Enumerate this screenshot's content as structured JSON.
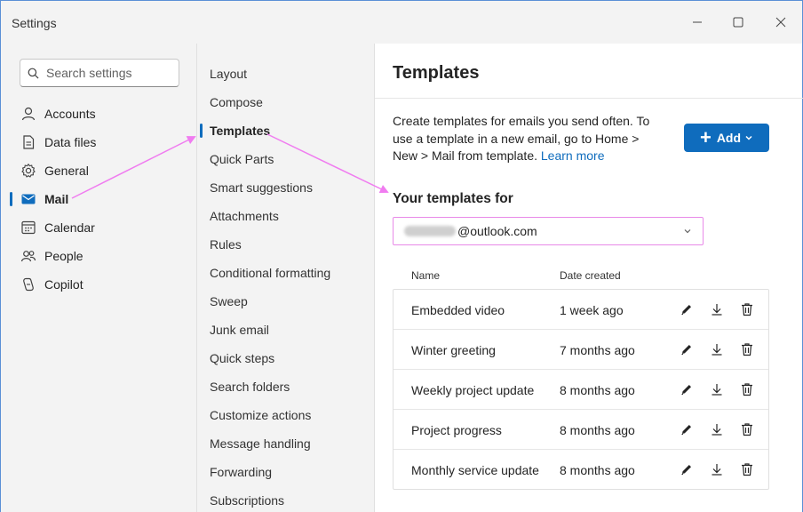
{
  "window": {
    "title": "Settings"
  },
  "search": {
    "placeholder": "Search settings"
  },
  "leftnav": {
    "items": [
      {
        "label": "Accounts",
        "icon": "person-icon"
      },
      {
        "label": "Data files",
        "icon": "document-icon"
      },
      {
        "label": "General",
        "icon": "gear-icon"
      },
      {
        "label": "Mail",
        "icon": "mail-icon",
        "active": true
      },
      {
        "label": "Calendar",
        "icon": "calendar-icon"
      },
      {
        "label": "People",
        "icon": "people-icon"
      },
      {
        "label": "Copilot",
        "icon": "copilot-icon"
      }
    ]
  },
  "midnav": {
    "items": [
      "Layout",
      "Compose",
      "Templates",
      "Quick Parts",
      "Smart suggestions",
      "Attachments",
      "Rules",
      "Conditional formatting",
      "Sweep",
      "Junk email",
      "Quick steps",
      "Search folders",
      "Customize actions",
      "Message handling",
      "Forwarding",
      "Subscriptions"
    ],
    "active": "Templates"
  },
  "content": {
    "title": "Templates",
    "description": "Create templates for emails you send often. To use a template in a new email, go to Home > New > Mail from template.",
    "learn_more": "Learn more",
    "add_label": "Add",
    "templates_for_label": "Your templates for",
    "account_suffix": "@outlook.com",
    "columns": {
      "name": "Name",
      "date": "Date created"
    },
    "rows": [
      {
        "name": "Embedded video",
        "date": "1 week ago"
      },
      {
        "name": "Winter greeting",
        "date": "7 months ago"
      },
      {
        "name": "Weekly project update",
        "date": "8 months ago"
      },
      {
        "name": "Project progress",
        "date": "8 months ago"
      },
      {
        "name": "Monthly service update",
        "date": "8 months ago"
      }
    ]
  },
  "colors": {
    "accent": "#0f6cbd",
    "annotation": "#f07cf0"
  }
}
